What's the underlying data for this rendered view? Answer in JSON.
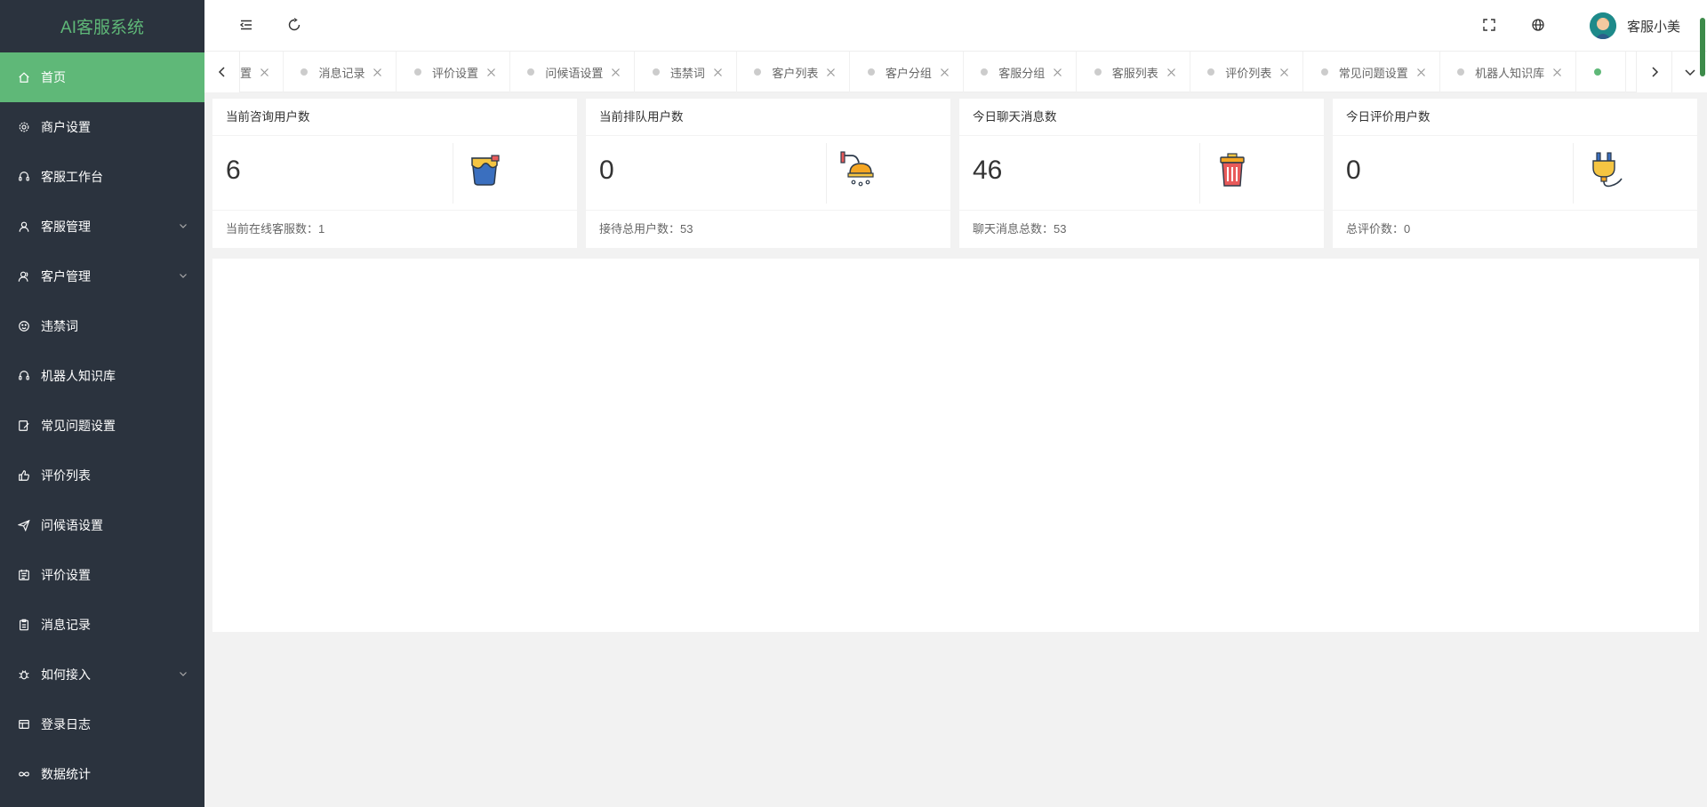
{
  "app": {
    "title": "AI客服系统"
  },
  "sidebar": {
    "items": [
      {
        "label": "首页",
        "icon": "home-icon",
        "active": true
      },
      {
        "label": "商户设置",
        "icon": "gear-icon"
      },
      {
        "label": "客服工作台",
        "icon": "headset-icon"
      },
      {
        "label": "客服管理",
        "icon": "user-icon",
        "expandable": true
      },
      {
        "label": "客户管理",
        "icon": "users-icon",
        "expandable": true
      },
      {
        "label": "违禁词",
        "icon": "smile-icon"
      },
      {
        "label": "机器人知识库",
        "icon": "headset-icon"
      },
      {
        "label": "常见问题设置",
        "icon": "edit-icon"
      },
      {
        "label": "评价列表",
        "icon": "thumb-up-icon"
      },
      {
        "label": "问候语设置",
        "icon": "send-icon"
      },
      {
        "label": "评价设置",
        "icon": "list-icon"
      },
      {
        "label": "消息记录",
        "icon": "clipboard-icon"
      },
      {
        "label": "如何接入",
        "icon": "bug-icon",
        "expandable": true
      },
      {
        "label": "登录日志",
        "icon": "table-icon"
      },
      {
        "label": "数据统计",
        "icon": "infinity-icon"
      }
    ]
  },
  "header": {
    "user_name": "客服小美"
  },
  "tabs": {
    "items": [
      {
        "label": "置"
      },
      {
        "label": "消息记录"
      },
      {
        "label": "评价设置"
      },
      {
        "label": "问候语设置"
      },
      {
        "label": "违禁词"
      },
      {
        "label": "客户列表"
      },
      {
        "label": "客户分组"
      },
      {
        "label": "客服分组"
      },
      {
        "label": "客服列表"
      },
      {
        "label": "评价列表"
      },
      {
        "label": "常见问题设置"
      },
      {
        "label": "机器人知识库"
      }
    ]
  },
  "cards": [
    {
      "title": "当前咨询用户数",
      "value": "6",
      "footer": "当前在线客服数：1",
      "icon": "paint-bucket-icon"
    },
    {
      "title": "当前排队用户数",
      "value": "0",
      "footer": "接待总用户数：53",
      "icon": "shower-icon"
    },
    {
      "title": "今日聊天消息数",
      "value": "46",
      "footer": "聊天消息总数：53",
      "icon": "trash-can-icon"
    },
    {
      "title": "今日评价用户数",
      "value": "0",
      "footer": "总评价数：0",
      "icon": "plug-icon"
    }
  ],
  "colors": {
    "accent": "#5fb878",
    "sidebar_bg": "#2b333e"
  }
}
